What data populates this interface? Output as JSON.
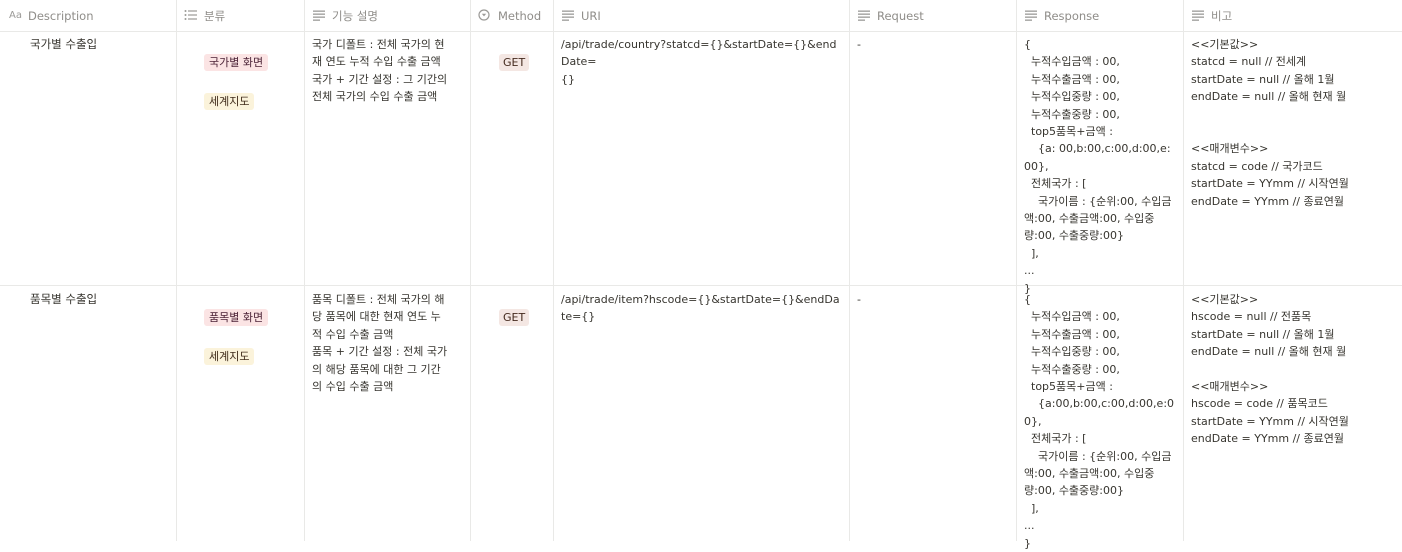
{
  "columns": [
    {
      "label": "Description",
      "icon": "title-icon"
    },
    {
      "label": "분류",
      "icon": "multi-select-icon"
    },
    {
      "label": "기능 설명",
      "icon": "text-icon"
    },
    {
      "label": "Method",
      "icon": "select-icon"
    },
    {
      "label": "URI",
      "icon": "text-icon"
    },
    {
      "label": "Request",
      "icon": "text-icon"
    },
    {
      "label": "Response",
      "icon": "text-icon"
    },
    {
      "label": "비고",
      "icon": "text-icon"
    }
  ],
  "rows": [
    {
      "description": "국가별 수출입",
      "tags": [
        {
          "label": "국가별 화면",
          "color": "#fbe4e4"
        },
        {
          "label": "세계지도",
          "color": "#fbf3db"
        }
      ],
      "feature": "국가 디폴트 : 전체 국가의 현\n재 연도 누적 수입 수출 금액\n국가 + 기간 설정 : 그 기간의\n전체 국가의 수입 수출 금액",
      "method": "GET",
      "uri": "/api/trade/country?statcd={}&startDate={}&endDate=\n{}",
      "request": "-",
      "response": "{\n  누적수입금액 : 00,\n  누적수출금액 : 00,\n  누적수입중량 : 00,\n  누적수출중량 : 00,\n  top5품목+금액 :\n    {a: 00,b:00,c:00,d:00,e:00},\n  전체국가 : [\n    국가이름 : {순위:00, 수입금\n액:00, 수출금액:00, 수입중\n량:00, 수출중량:00}\n  ],\n...\n}",
      "note": "<<기본값>>\nstatcd = null // 전세계\nstartDate = null // 올해 1월\nendDate = null // 올해 현재 월\n\n\n<<매개변수>>\nstatcd = code // 국가코드\nstartDate = YYmm // 시작연월\nendDate = YYmm // 종료연월"
    },
    {
      "description": "품목별 수출입",
      "tags": [
        {
          "label": "품목별 화면",
          "color": "#fbe4e4"
        },
        {
          "label": "세계지도",
          "color": "#fbf3db"
        }
      ],
      "feature": "품목 디폴트 : 전체 국가의 해\n당 품목에 대한 현재 연도 누\n적 수입 수출 금액\n품목 + 기간 설정 : 전체 국가\n의 해당 품목에 대한 그 기간\n의 수입 수출 금액",
      "method": "GET",
      "uri": "/api/trade/item?hscode={}&startDate={}&endDate={}",
      "request": "-",
      "response": "{\n  누적수입금액 : 00,\n  누적수출금액 : 00,\n  누적수입중량 : 00,\n  누적수출중량 : 00,\n  top5품목+금액 :\n    {a:00,b:00,c:00,d:00,e:00},\n  전체국가 : [\n    국가이름 : {순위:00, 수입금\n액:00, 수출금액:00, 수입중\n량:00, 수출중량:00}\n  ],\n...\n}",
      "note": "<<기본값>>\nhscode = null // 전품목\nstartDate = null // 올해 1월\nendDate = null // 올해 현재 월\n\n<<매개변수>>\nhscode = code // 품목코드\nstartDate = YYmm // 시작연월\nendDate = YYmm // 종료연월"
    }
  ]
}
